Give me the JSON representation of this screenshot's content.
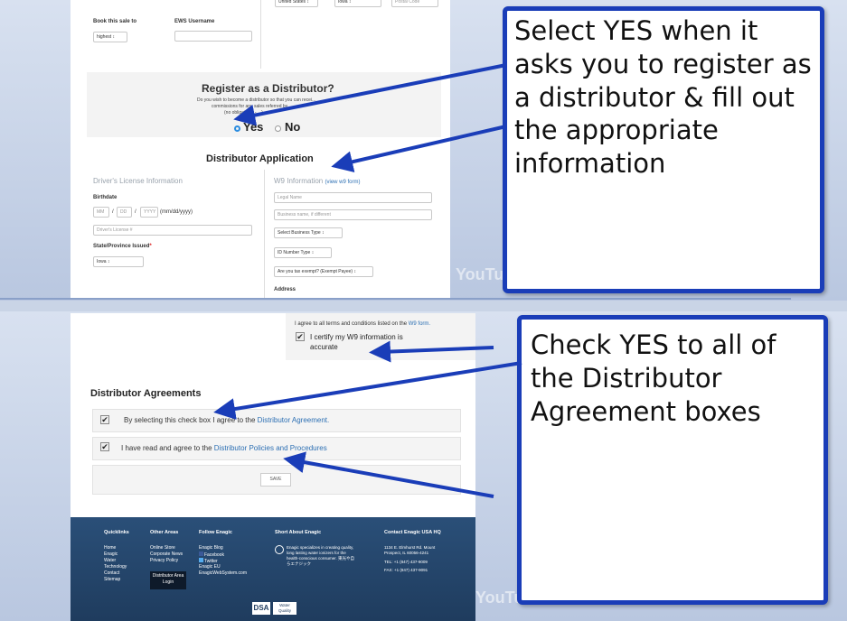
{
  "top": {
    "address_row": {
      "country": "United States",
      "state": "Iowa",
      "postal_placeholder": "Postal Code"
    },
    "book_sale_label": "Book this sale to",
    "book_sale_value": "highest",
    "ews_username_label": "EWS Username",
    "register": {
      "title": "Register as a Distributor?",
      "desc_line1": "Do you wish to become a distributor so that you can recei...",
      "desc_line2": "commissions for any sales referred by ...",
      "desc_line3": "(no obligations - ...)",
      "yes_label": "Yes",
      "no_label": "No"
    },
    "app_title": "Distributor Application",
    "license": {
      "title": "Driver's License Information",
      "birthdate_label": "Birthdate",
      "mm": "MM",
      "dd": "DD",
      "yyyy": "YYYY",
      "date_format": "(mm/dd/yyyy)",
      "license_placeholder": "Driver's License #",
      "state_label": "State/Province Issued",
      "required_mark": "*",
      "state_value": "Iowa",
      "slash": "/"
    },
    "w9": {
      "title": "W9 Information",
      "view_link": "(view w9 form)",
      "legal_name_placeholder": "Legal Name",
      "business_name_placeholder": "Business name, if different",
      "business_type": "Select Business Type",
      "id_number_type": "ID Number Type",
      "tax_exempt": "Are you tax exempt? (Exempt Payee)",
      "address_label": "Address"
    }
  },
  "bottom": {
    "agree_terms": "I agree to all terms and conditions listed on the",
    "w9_form_link": "W9 form.",
    "certify_label": "I certify my W9 information is accurate",
    "agreements_title": "Distributor Agreements",
    "agreement1_text": "By selecting this check box I agree to the",
    "agreement1_link": "Distributor Agreement.",
    "agreement2_text": "I have read and agree to the",
    "agreement2_link": "Distributor Policies and Procedures",
    "save_label": "SAVE",
    "footer": {
      "quicklinks_h": "Quicklinks",
      "quicklinks": [
        "Home",
        "Enagic",
        "Water",
        "Technology",
        "Contact",
        "Sitemap"
      ],
      "other_h": "Other Areas",
      "other": [
        "Online Store",
        "Corporate News",
        "Privacy Policy"
      ],
      "dist_login": "Distributor Area Login",
      "follow_h": "Follow Enagic",
      "follow": [
        "Enagic Blog",
        "Facebook",
        "Twitter",
        "Enagic EU",
        "EnagicWebSystem.com"
      ],
      "short_h": "Short About Enagic",
      "short_text": "Enagic specializes in creating quality, long lasting water ionizers for the health-conscious consumer. 東光や自らエナジック",
      "contact_h": "Contact Enagic USA HQ",
      "contact_addr": "1134 E. Elmhurst Rd. Mount Prospect, IL 60056-4241",
      "contact_tel": "TEL: +1 (847) 437-9009",
      "contact_fax": "FAX: +1 (847) 437-9091",
      "badge_dsa": "DSA",
      "badge_wq": "Water Quality"
    }
  },
  "callouts": {
    "one": "Select YES when it asks you to register as a distributor & fill out the appropriate information",
    "two": "Check YES to all of the Distributor Agreement boxes"
  },
  "watermark": "YouTube",
  "colors": {
    "callout_border": "#1a3db8",
    "arrow": "#1a3db8",
    "footer_bg": "#2a4f78",
    "link": "#2c6fb3"
  }
}
